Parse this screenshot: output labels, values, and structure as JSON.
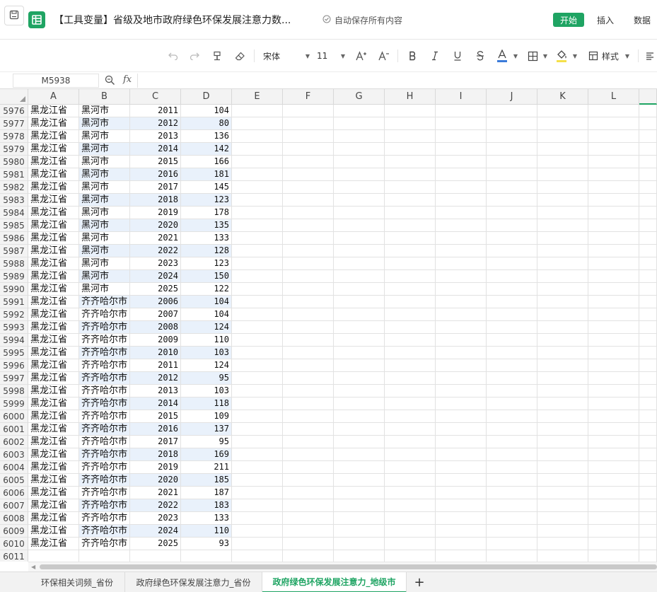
{
  "title_bar": {
    "doc_title": "【工具变量】省级及地市政府绿色环保发展注意力数...",
    "autosave": "自动保存所有内容",
    "menu": [
      "开始",
      "插入",
      "数据"
    ]
  },
  "toolbar": {
    "font_name": "宋体",
    "font_size": "11",
    "style_label": "样式",
    "font_color": "#3b7bd9",
    "fill_color": "#f5e04a"
  },
  "formula_bar": {
    "cell_ref": "M5938",
    "fx": "fx",
    "value": ""
  },
  "columns": [
    "A",
    "B",
    "C",
    "D",
    "E",
    "F",
    "G",
    "H",
    "I",
    "J",
    "K",
    "L"
  ],
  "rows": [
    {
      "n": "5976",
      "a": "黑龙江省",
      "b": "黑河市",
      "c": "2011",
      "d": "104"
    },
    {
      "n": "5977",
      "a": "黑龙江省",
      "b": "黑河市",
      "c": "2012",
      "d": "80"
    },
    {
      "n": "5978",
      "a": "黑龙江省",
      "b": "黑河市",
      "c": "2013",
      "d": "136"
    },
    {
      "n": "5979",
      "a": "黑龙江省",
      "b": "黑河市",
      "c": "2014",
      "d": "142"
    },
    {
      "n": "5980",
      "a": "黑龙江省",
      "b": "黑河市",
      "c": "2015",
      "d": "166"
    },
    {
      "n": "5981",
      "a": "黑龙江省",
      "b": "黑河市",
      "c": "2016",
      "d": "181"
    },
    {
      "n": "5982",
      "a": "黑龙江省",
      "b": "黑河市",
      "c": "2017",
      "d": "145"
    },
    {
      "n": "5983",
      "a": "黑龙江省",
      "b": "黑河市",
      "c": "2018",
      "d": "123"
    },
    {
      "n": "5984",
      "a": "黑龙江省",
      "b": "黑河市",
      "c": "2019",
      "d": "178"
    },
    {
      "n": "5985",
      "a": "黑龙江省",
      "b": "黑河市",
      "c": "2020",
      "d": "135"
    },
    {
      "n": "5986",
      "a": "黑龙江省",
      "b": "黑河市",
      "c": "2021",
      "d": "133"
    },
    {
      "n": "5987",
      "a": "黑龙江省",
      "b": "黑河市",
      "c": "2022",
      "d": "128"
    },
    {
      "n": "5988",
      "a": "黑龙江省",
      "b": "黑河市",
      "c": "2023",
      "d": "123"
    },
    {
      "n": "5989",
      "a": "黑龙江省",
      "b": "黑河市",
      "c": "2024",
      "d": "150"
    },
    {
      "n": "5990",
      "a": "黑龙江省",
      "b": "黑河市",
      "c": "2025",
      "d": "122"
    },
    {
      "n": "5991",
      "a": "黑龙江省",
      "b": "齐齐哈尔市",
      "c": "2006",
      "d": "104"
    },
    {
      "n": "5992",
      "a": "黑龙江省",
      "b": "齐齐哈尔市",
      "c": "2007",
      "d": "104"
    },
    {
      "n": "5993",
      "a": "黑龙江省",
      "b": "齐齐哈尔市",
      "c": "2008",
      "d": "124"
    },
    {
      "n": "5994",
      "a": "黑龙江省",
      "b": "齐齐哈尔市",
      "c": "2009",
      "d": "110"
    },
    {
      "n": "5995",
      "a": "黑龙江省",
      "b": "齐齐哈尔市",
      "c": "2010",
      "d": "103"
    },
    {
      "n": "5996",
      "a": "黑龙江省",
      "b": "齐齐哈尔市",
      "c": "2011",
      "d": "124"
    },
    {
      "n": "5997",
      "a": "黑龙江省",
      "b": "齐齐哈尔市",
      "c": "2012",
      "d": "95"
    },
    {
      "n": "5998",
      "a": "黑龙江省",
      "b": "齐齐哈尔市",
      "c": "2013",
      "d": "103"
    },
    {
      "n": "5999",
      "a": "黑龙江省",
      "b": "齐齐哈尔市",
      "c": "2014",
      "d": "118"
    },
    {
      "n": "6000",
      "a": "黑龙江省",
      "b": "齐齐哈尔市",
      "c": "2015",
      "d": "109"
    },
    {
      "n": "6001",
      "a": "黑龙江省",
      "b": "齐齐哈尔市",
      "c": "2016",
      "d": "137"
    },
    {
      "n": "6002",
      "a": "黑龙江省",
      "b": "齐齐哈尔市",
      "c": "2017",
      "d": "95"
    },
    {
      "n": "6003",
      "a": "黑龙江省",
      "b": "齐齐哈尔市",
      "c": "2018",
      "d": "169"
    },
    {
      "n": "6004",
      "a": "黑龙江省",
      "b": "齐齐哈尔市",
      "c": "2019",
      "d": "211"
    },
    {
      "n": "6005",
      "a": "黑龙江省",
      "b": "齐齐哈尔市",
      "c": "2020",
      "d": "185"
    },
    {
      "n": "6006",
      "a": "黑龙江省",
      "b": "齐齐哈尔市",
      "c": "2021",
      "d": "187"
    },
    {
      "n": "6007",
      "a": "黑龙江省",
      "b": "齐齐哈尔市",
      "c": "2022",
      "d": "183"
    },
    {
      "n": "6008",
      "a": "黑龙江省",
      "b": "齐齐哈尔市",
      "c": "2023",
      "d": "133"
    },
    {
      "n": "6009",
      "a": "黑龙江省",
      "b": "齐齐哈尔市",
      "c": "2024",
      "d": "110"
    },
    {
      "n": "6010",
      "a": "黑龙江省",
      "b": "齐齐哈尔市",
      "c": "2025",
      "d": "93"
    },
    {
      "n": "6011",
      "a": "",
      "b": "",
      "c": "",
      "d": ""
    }
  ],
  "sheet_tabs": [
    "环保相关词频_省份",
    "政府绿色环保发展注意力_省份",
    "政府绿色环保发展注意力_地级市"
  ],
  "active_tab": 2,
  "add_tab": "+"
}
